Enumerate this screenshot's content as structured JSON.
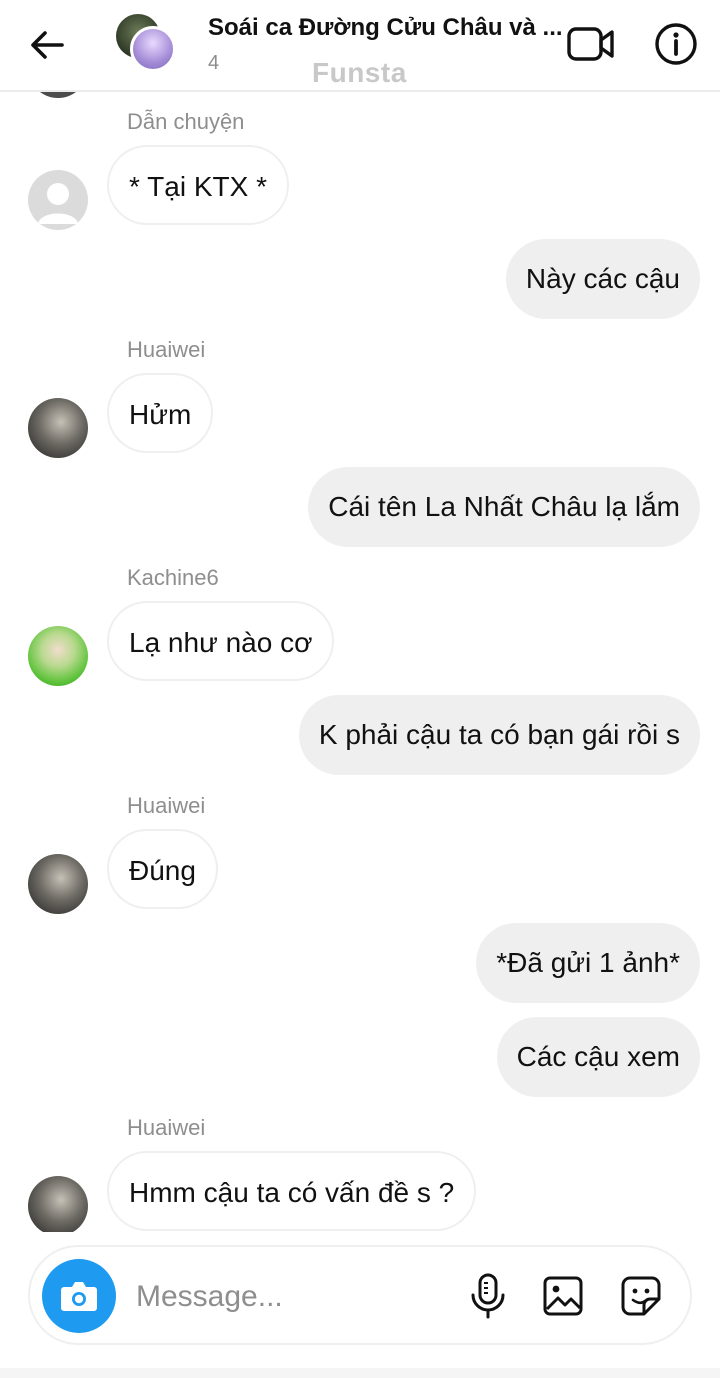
{
  "header": {
    "title": "Soái ca Đường Cửu Châu và ...",
    "member_count": "4",
    "watermark": "Funsta"
  },
  "messages": [
    {
      "direction": "in",
      "sender": "Dẫn chuyện",
      "avatar": "default-avatar",
      "text": "* Tại KTX *"
    },
    {
      "direction": "out",
      "text": "Này các cậu"
    },
    {
      "direction": "in",
      "sender": "Huaiwei",
      "avatar": "huaiwei-avatar",
      "text": "Hửm"
    },
    {
      "direction": "out",
      "text": "Cái tên La Nhất Châu lạ lắm"
    },
    {
      "direction": "in",
      "sender": "Kachine6",
      "avatar": "kachine6-avatar",
      "text": "Lạ như nào cơ"
    },
    {
      "direction": "out",
      "text": "K phải cậu ta có bạn gái rồi s"
    },
    {
      "direction": "in",
      "sender": "Huaiwei",
      "avatar": "huaiwei-avatar",
      "text": "Đúng"
    },
    {
      "direction": "out",
      "text": "*Đã gửi 1 ảnh*"
    },
    {
      "direction": "out",
      "text": "Các cậu xem"
    },
    {
      "direction": "in",
      "sender": "Huaiwei",
      "avatar": "huaiwei-avatar",
      "text": "Hmm cậu ta có vấn đề s ?"
    }
  ],
  "composer": {
    "placeholder": "Message..."
  },
  "colors": {
    "accent": "#1e9bf0",
    "outgoing_bubble": "#efefef",
    "secondary_text": "#8e8e8e"
  },
  "icons": [
    "back-arrow-icon",
    "video-call-icon",
    "info-icon",
    "camera-icon",
    "microphone-icon",
    "gallery-icon",
    "sticker-icon"
  ]
}
